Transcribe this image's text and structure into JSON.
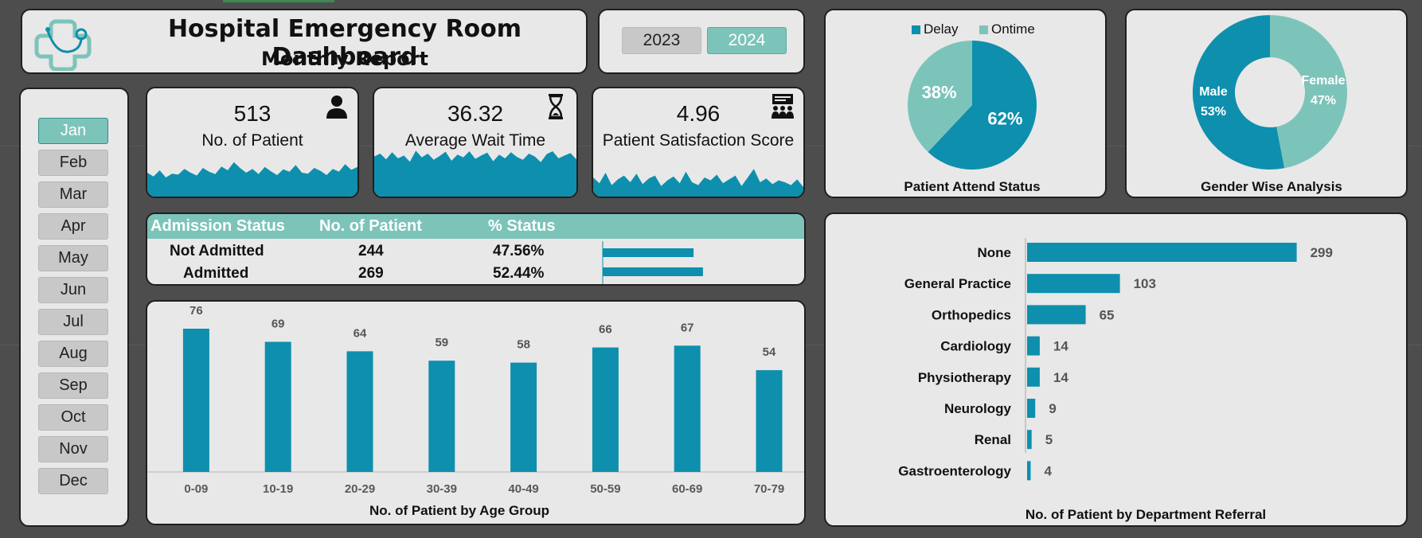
{
  "header": {
    "title": "Hospital Emergency Room Dashboard",
    "subtitle": "Monthly Report"
  },
  "years": [
    {
      "label": "2023",
      "selected": false
    },
    {
      "label": "2024",
      "selected": true
    }
  ],
  "months": [
    {
      "label": "Jan",
      "selected": true
    },
    {
      "label": "Feb",
      "selected": false
    },
    {
      "label": "Mar",
      "selected": false
    },
    {
      "label": "Apr",
      "selected": false
    },
    {
      "label": "May",
      "selected": false
    },
    {
      "label": "Jun",
      "selected": false
    },
    {
      "label": "Jul",
      "selected": false
    },
    {
      "label": "Aug",
      "selected": false
    },
    {
      "label": "Sep",
      "selected": false
    },
    {
      "label": "Oct",
      "selected": false
    },
    {
      "label": "Nov",
      "selected": false
    },
    {
      "label": "Dec",
      "selected": false
    }
  ],
  "kpis": [
    {
      "value": "513",
      "label": "No. of Patient",
      "icon": "person-icon"
    },
    {
      "value": "36.32",
      "label": "Average Wait Time",
      "icon": "hourglass-icon"
    },
    {
      "value": "4.96",
      "label": "Patient Satisfaction Score",
      "icon": "presentation-group-icon"
    }
  ],
  "admission": {
    "headers": [
      "Admission Status",
      "No. of Patient",
      "% Status"
    ],
    "rows": [
      {
        "status": "Not Admitted",
        "count": "244",
        "percent": "47.56%",
        "share": 0.4756
      },
      {
        "status": "Admitted",
        "count": "269",
        "percent": "52.44%",
        "share": 0.5244
      }
    ]
  },
  "colors": {
    "teal": "#0e8fad",
    "mint": "#7cc4ba",
    "card": "#e8e8e8",
    "background": "#4d4d4d"
  },
  "chart_data": [
    {
      "type": "area",
      "id": "patients-trend",
      "values": [
        0.5,
        0.42,
        0.55,
        0.4,
        0.48,
        0.46,
        0.58,
        0.5,
        0.44,
        0.6,
        0.52,
        0.47,
        0.63,
        0.55,
        0.72,
        0.6,
        0.5,
        0.58,
        0.47,
        0.62,
        0.53,
        0.45,
        0.57,
        0.52,
        0.66,
        0.5,
        0.48,
        0.6,
        0.54,
        0.45,
        0.58,
        0.52,
        0.68,
        0.56,
        0.62
      ]
    },
    {
      "type": "area",
      "id": "wait-time-trend",
      "values": [
        0.84,
        0.9,
        0.78,
        0.93,
        0.8,
        0.86,
        0.73,
        0.96,
        0.82,
        0.9,
        0.77,
        0.85,
        0.94,
        0.75,
        0.88,
        0.82,
        0.95,
        0.79,
        0.86,
        0.92,
        0.74,
        0.88,
        0.8,
        0.93,
        0.83,
        0.77,
        0.9,
        0.84,
        0.72,
        0.89,
        0.95,
        0.8,
        0.86,
        0.91,
        0.78
      ]
    },
    {
      "type": "area",
      "id": "satisfaction-trend",
      "values": [
        0.4,
        0.28,
        0.5,
        0.24,
        0.36,
        0.44,
        0.3,
        0.48,
        0.26,
        0.38,
        0.44,
        0.22,
        0.34,
        0.42,
        0.28,
        0.52,
        0.3,
        0.24,
        0.4,
        0.34,
        0.46,
        0.28,
        0.36,
        0.44,
        0.22,
        0.4,
        0.58,
        0.3,
        0.38,
        0.26,
        0.34,
        0.3,
        0.24,
        0.36,
        0.2
      ]
    },
    {
      "type": "pie",
      "title": "Patient Attend Status",
      "legend": [
        "Delay",
        "Ontime"
      ],
      "series": [
        {
          "name": "Delay",
          "value": 62,
          "label": "62%",
          "color": "#0e8fad"
        },
        {
          "name": "Ontime",
          "value": 38,
          "label": "38%",
          "color": "#7cc4ba"
        }
      ]
    },
    {
      "type": "pie",
      "title": "Gender Wise Analysis",
      "series": [
        {
          "name": "Male",
          "value": 53,
          "label": "53%",
          "color": "#0e8fad"
        },
        {
          "name": "Female",
          "value": 47,
          "label": "47%",
          "color": "#7cc4ba"
        }
      ]
    },
    {
      "type": "bar",
      "title": "No. of Patient by Age Group",
      "categories": [
        "0-09",
        "10-19",
        "20-29",
        "30-39",
        "40-49",
        "50-59",
        "60-69",
        "70-79"
      ],
      "values": [
        76,
        69,
        64,
        59,
        58,
        66,
        67,
        54
      ],
      "ylim": [
        0,
        80
      ]
    },
    {
      "type": "bar",
      "orientation": "horizontal",
      "title": "No. of Patient by Department Referral",
      "categories": [
        "None",
        "General Practice",
        "Orthopedics",
        "Cardiology",
        "Physiotherapy",
        "Neurology",
        "Renal",
        "Gastroenterology"
      ],
      "values": [
        299,
        103,
        65,
        14,
        14,
        9,
        5,
        4
      ],
      "xlim": [
        0,
        340
      ]
    }
  ]
}
